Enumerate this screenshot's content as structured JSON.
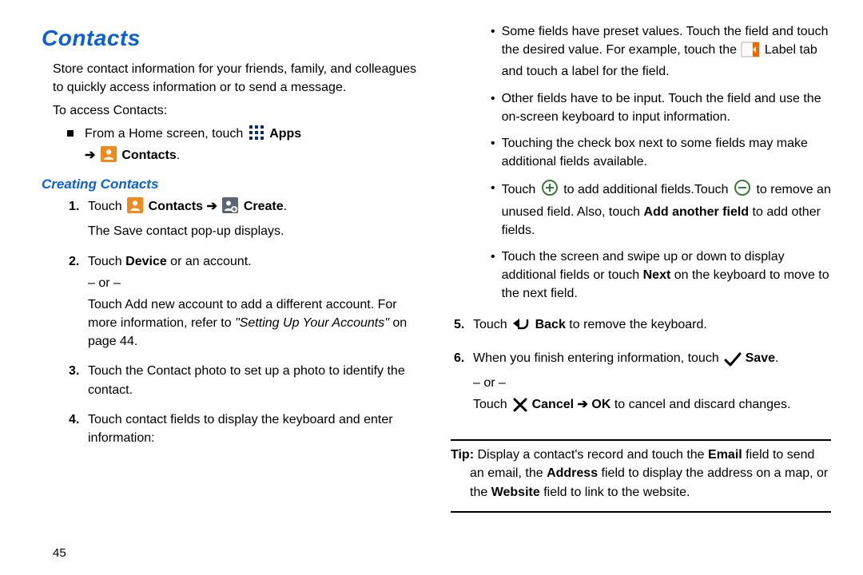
{
  "left": {
    "title": "Contacts",
    "intro": "Store contact information for your friends, family, and colleagues to quickly access information or to send a message.",
    "access_heading": "To access Contacts:",
    "bullet_prefix": "From a Home screen, touch",
    "apps_label": "Apps",
    "contacts_label": "Contacts",
    "period": ".",
    "subheading": "Creating Contacts",
    "step1_touch": "Touch",
    "step1_contacts": "Contacts",
    "step1_create": "Create",
    "step1_line2": "The Save contact pop-up displays.",
    "step2_line1a": "Touch ",
    "step2_line1b": "Device",
    "step2_line1c": " or an account.",
    "or": "– or –",
    "step2_line2a": "Touch Add new account to add a different account. For more information, refer to ",
    "step2_ref": "\"Setting Up Your Accounts\"",
    "step2_line2b": " on page 44.",
    "step3": "Touch the Contact photo to set up a photo to identify the contact.",
    "step4": "Touch contact fields to display the keyboard and enter information:",
    "pagenum": "45"
  },
  "right": {
    "b1a": "Some fields have preset values. Touch the field and touch the desired value. For example, touch the ",
    "b1b": " Label tab and touch a label for the field.",
    "b2": "Other fields have to be input. Touch the field and use the on-screen keyboard to input information.",
    "b3": "Touching the check box next to some fields may make additional fields available.",
    "b4_touch": "Touch ",
    "b4_mid": " to add additional fields.Touch ",
    "b4_end_a": " to remove an unused field. Also, touch ",
    "b4_bold": "Add another field",
    "b4_end_b": " to add other fields.",
    "b5a": "Touch the screen and swipe up or down to display additional fields or touch ",
    "b5_bold": "Next",
    "b5b": " on the keyboard to move to the next field.",
    "s5_touch": "Touch ",
    "s5_back": "Back",
    "s5_end": " to remove the keyboard.",
    "s6_a": "When you finish entering information, touch ",
    "s6_save": "Save",
    "s6_period": ".",
    "s6_touch": "Touch ",
    "s6_cancel": "Cancel",
    "s6_ok": "OK",
    "s6_end": " to cancel and discard changes.",
    "tip_label": "Tip:",
    "tip_a": " Display a contact's record and touch the ",
    "tip_email": "Email",
    "tip_b": " field to send an email, the ",
    "tip_address": "Address",
    "tip_c": " field to display the address on a map, or the ",
    "tip_website": "Website",
    "tip_d": " field to link to the website."
  }
}
